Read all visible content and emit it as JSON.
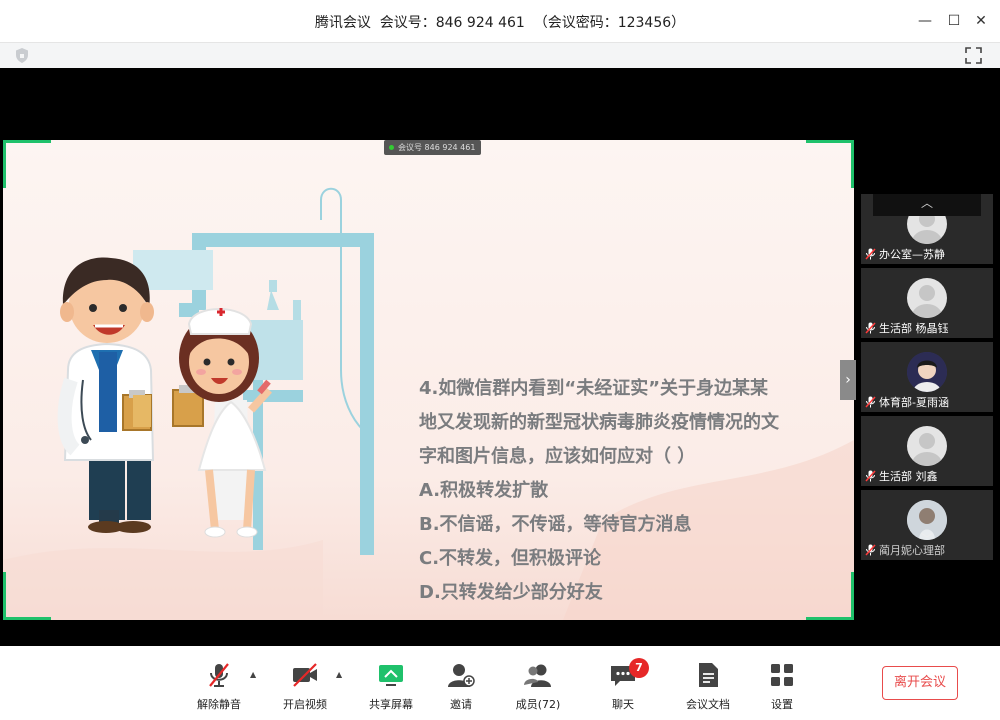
{
  "window": {
    "title": "腾讯会议  会议号：846 924 461  （会议密码：123456）",
    "controls": {
      "minimize": "—",
      "maximize": "☐",
      "close": "✕"
    }
  },
  "slide": {
    "meeting_tag": "会议号 846 924 461",
    "question_lines": [
      "4.如微信群内看到“未经证实”关于身边某某",
      "地又发现新的新型冠状病毒肺炎疫情情况的文",
      "字和图片信息，应该如何应对（    ）",
      "A.积极转发扩散",
      "B.不信谣，不传谣，等待官方消息",
      "C.不转发，但积极评论",
      "D.只转发给少部分好友"
    ],
    "side_arrow": "›"
  },
  "participants": {
    "collapse_up": "︿",
    "collapse_down": "﹀",
    "items": [
      {
        "name": "办公室—苏静"
      },
      {
        "name": "生活部 杨晶钰"
      },
      {
        "name": "体育部-夏雨涵"
      },
      {
        "name": "生活部 刘鑫"
      },
      {
        "name": "蔺月妮心理部"
      }
    ]
  },
  "toolbar": {
    "unmute_label": "解除静音",
    "video_label": "开启视频",
    "share_label": "共享屏幕",
    "invite_label": "邀请",
    "members_label": "成员(72)",
    "chat_label": "聊天",
    "chat_badge": "7",
    "docs_label": "会议文档",
    "settings_label": "设置",
    "caret": "▲",
    "leave_label": "离开会议"
  },
  "colors": {
    "accent_green": "#1fc16b",
    "leave_red": "#e84c4c",
    "badge_red": "#e62828",
    "stage_bg": "#000000",
    "slide_text": "#7a7c7f"
  }
}
